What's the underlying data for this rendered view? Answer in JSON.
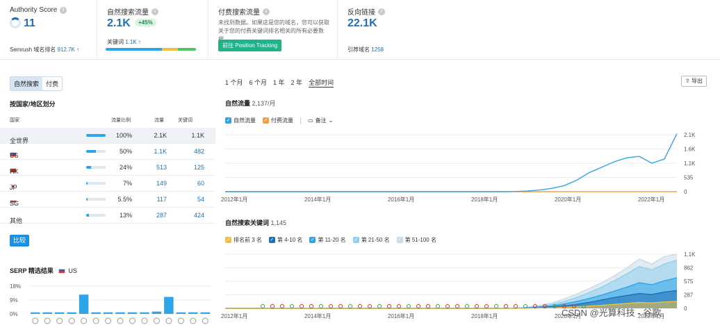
{
  "metrics": {
    "authority": {
      "title": "Authority Score",
      "value": "11",
      "sub_label": "Semrush 域名排名",
      "sub_value": "912.7K ↑"
    },
    "organic": {
      "title": "自然搜索流量",
      "value": "2.1K",
      "growth": "+45%",
      "kw_label": "关键词",
      "kw_value": "1.1K ↑"
    },
    "paid": {
      "title": "付费搜索流量",
      "note": "未找到数据。如果这是您的域名，您可以获取关于您的付费关键词排名相关的所有必要数据。",
      "button": "前往 Position Tracking"
    },
    "backlinks": {
      "title": "反向链接",
      "value": "22.1K",
      "sub_label": "引荐域名",
      "sub_value": "1258"
    }
  },
  "left": {
    "tabs": [
      "自然搜索",
      "付费"
    ],
    "section_title": "按国家/地区划分",
    "columns": [
      "国家",
      "流量比例",
      "流量",
      "关键词"
    ],
    "rows": [
      {
        "name": "全世界",
        "flag": "",
        "share": "100%",
        "share_frac": 1.0,
        "traffic": "2.1K",
        "keywords": "1.1K"
      },
      {
        "name": "US",
        "flag": "us",
        "share": "50%",
        "share_frac": 0.5,
        "traffic": "1.1K",
        "keywords": "482"
      },
      {
        "name": "HK",
        "flag": "hk",
        "share": "24%",
        "share_frac": 0.24,
        "traffic": "513",
        "keywords": "125"
      },
      {
        "name": "JP",
        "flag": "jp",
        "share": "7%",
        "share_frac": 0.07,
        "traffic": "149",
        "keywords": "60"
      },
      {
        "name": "SG",
        "flag": "sg",
        "share": "5.5%",
        "share_frac": 0.055,
        "traffic": "117",
        "keywords": "54"
      },
      {
        "name": "其他",
        "flag": "",
        "share": "13%",
        "share_frac": 0.13,
        "traffic": "287",
        "keywords": "424"
      }
    ],
    "compare_button": "比较",
    "serp_title": "SERP 精选结果",
    "serp_country": "US"
  },
  "right": {
    "ranges": [
      "1 个月",
      "6 个月",
      "1 年",
      "2 年",
      "全部时间"
    ],
    "export_label": "导出",
    "traffic_title": "自然流量",
    "traffic_value": "2,137/月",
    "traffic_legend": [
      "自然流量",
      "付费流量"
    ],
    "notes_label": "备注",
    "keywords_title": "自然搜索关键词",
    "keywords_value": "1,145",
    "keywords_legend": [
      "排名前 3 名",
      "第 4-10 名",
      "第 11-20 名",
      "第 21-50 名",
      "第 51-100 名"
    ]
  },
  "colors": {
    "accent": "#1e6fb8",
    "organic": "#2fa4e7",
    "paid": "#f0a040",
    "green": "#1fb38a"
  },
  "chart_data": [
    {
      "type": "area",
      "title": "自然流量",
      "x": [
        "2012年1月",
        "2014年1月",
        "2016年1月",
        "2018年1月",
        "2020年1月",
        "2022年1月"
      ],
      "ylim": [
        0,
        2100
      ],
      "y_ticks": [
        "2.1K",
        "1.6K",
        "1.1K",
        "535",
        "0"
      ],
      "series": [
        {
          "name": "自然流量",
          "values": [
            0,
            0,
            0,
            0,
            0,
            0,
            0,
            0,
            0,
            0,
            0,
            0,
            0,
            0,
            0,
            0,
            0,
            0,
            0,
            0,
            0,
            0,
            0,
            5,
            20,
            60,
            120,
            220,
            420,
            700,
            900,
            1100,
            1250,
            1300,
            1050,
            1200,
            2137
          ]
        },
        {
          "name": "付费流量",
          "values": [
            0,
            0,
            0,
            0,
            0,
            0,
            0,
            0,
            0,
            0,
            0,
            0,
            0,
            0,
            0,
            0,
            0,
            0,
            0,
            0,
            0,
            0,
            0,
            0,
            0,
            0,
            0,
            0,
            0,
            0,
            0,
            0,
            0,
            0,
            0,
            0,
            0
          ]
        }
      ]
    },
    {
      "type": "area",
      "title": "自然搜索关键词",
      "x": [
        "2012年1月",
        "2014年1月",
        "2016年1月",
        "2018年1月",
        "2020年1月",
        "2022年1月"
      ],
      "ylim": [
        0,
        1100
      ],
      "y_ticks": [
        "1.1K",
        "862",
        "575",
        "287",
        "0"
      ],
      "series": [
        {
          "name": "排名前 3 名",
          "values": [
            0,
            0,
            0,
            0,
            0,
            0,
            0,
            0,
            0,
            0,
            0,
            0,
            0,
            0,
            0,
            0,
            0,
            0,
            0,
            0,
            0,
            0,
            0,
            0,
            2,
            5,
            10,
            20,
            30,
            45,
            60,
            80,
            100,
            120,
            110,
            130,
            140
          ]
        },
        {
          "name": "第 4-10 名",
          "values": [
            0,
            0,
            0,
            0,
            0,
            0,
            0,
            0,
            0,
            0,
            0,
            0,
            0,
            0,
            0,
            0,
            0,
            0,
            0,
            0,
            0,
            0,
            0,
            2,
            6,
            15,
            30,
            50,
            80,
            120,
            170,
            220,
            260,
            300,
            280,
            330,
            360
          ]
        },
        {
          "name": "第 11-20 名",
          "values": [
            0,
            0,
            0,
            0,
            0,
            0,
            0,
            0,
            0,
            0,
            0,
            0,
            0,
            0,
            0,
            0,
            0,
            0,
            0,
            0,
            0,
            0,
            0,
            3,
            10,
            25,
            50,
            90,
            140,
            200,
            270,
            350,
            430,
            520,
            480,
            560,
            620
          ]
        },
        {
          "name": "第 21-50 名",
          "values": [
            0,
            0,
            0,
            0,
            0,
            0,
            0,
            0,
            0,
            0,
            0,
            0,
            0,
            0,
            0,
            0,
            0,
            0,
            0,
            0,
            0,
            0,
            0,
            4,
            15,
            40,
            80,
            140,
            220,
            320,
            430,
            560,
            700,
            850,
            780,
            900,
            980
          ]
        },
        {
          "name": "第 51-100 名",
          "values": [
            0,
            0,
            0,
            0,
            0,
            0,
            0,
            0,
            0,
            0,
            0,
            0,
            0,
            0,
            0,
            0,
            0,
            0,
            0,
            0,
            0,
            0,
            0,
            5,
            20,
            55,
            110,
            190,
            290,
            400,
            520,
            660,
            820,
            1000,
            900,
            1050,
            1100
          ]
        }
      ]
    },
    {
      "type": "bar",
      "title": "SERP 精选结果",
      "y_ticks": [
        "18%",
        "9%",
        "0%"
      ],
      "ylim": [
        0,
        18
      ],
      "values": [
        1,
        1,
        1,
        1,
        12.5,
        1,
        1,
        1,
        1,
        1,
        1.5,
        11,
        1,
        1,
        1
      ]
    }
  ],
  "watermark": "CSDN @光算科技 - 谷歌"
}
